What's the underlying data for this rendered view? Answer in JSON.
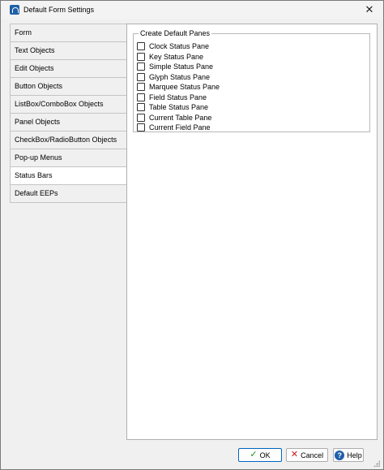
{
  "window": {
    "title": "Default Form Settings",
    "close_glyph": "✕"
  },
  "tabs": [
    {
      "label": "Form",
      "active": false
    },
    {
      "label": "Text Objects",
      "active": false
    },
    {
      "label": "Edit Objects",
      "active": false
    },
    {
      "label": "Button Objects",
      "active": false
    },
    {
      "label": "ListBox/ComboBox Objects",
      "active": false
    },
    {
      "label": "Panel Objects",
      "active": false
    },
    {
      "label": "CheckBox/RadioButton Objects",
      "active": false
    },
    {
      "label": "Pop-up Menus",
      "active": false
    },
    {
      "label": "Status Bars",
      "active": true
    },
    {
      "label": "Default EEPs",
      "active": false
    }
  ],
  "panel": {
    "group_title": "Create Default Panes",
    "options": [
      {
        "label": "Clock Status Pane",
        "checked": false
      },
      {
        "label": "Key Status Pane",
        "checked": false
      },
      {
        "label": "Simple Status Pane",
        "checked": false
      },
      {
        "label": "Glyph Status Pane",
        "checked": false
      },
      {
        "label": "Marquee Status Pane",
        "checked": false
      },
      {
        "label": "Field Status Pane",
        "checked": false
      },
      {
        "label": "Table Status Pane",
        "checked": false
      },
      {
        "label": "Current Table Pane",
        "checked": false
      },
      {
        "label": "Current Field Pane",
        "checked": false
      }
    ]
  },
  "buttons": {
    "ok": "OK",
    "cancel": "Cancel",
    "help": "Help"
  },
  "icons": {
    "app": "app-icon",
    "ok": "check-icon",
    "cancel": "x-icon",
    "help": "help-icon"
  },
  "colors": {
    "dialog_bg": "#f0f0f0",
    "panel_bg": "#ffffff",
    "ok_border": "#0067c0",
    "ok_check": "#1a9a1a",
    "cancel_x": "#c81e1e",
    "help_icon": "#1f5fa8"
  }
}
